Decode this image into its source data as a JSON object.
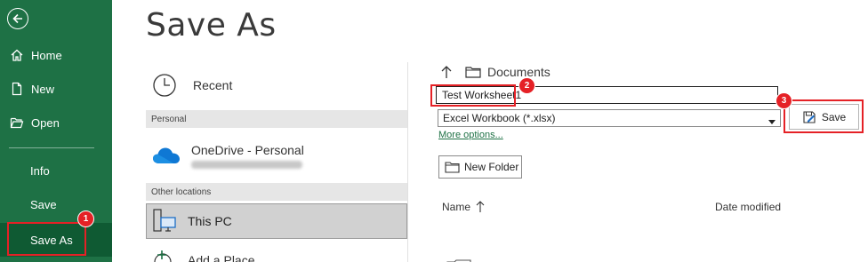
{
  "sidebar": {
    "back_icon": "back-arrow-icon",
    "items": [
      {
        "label": "Home",
        "icon": "home-icon"
      },
      {
        "label": "New",
        "icon": "new-document-icon"
      },
      {
        "label": "Open",
        "icon": "folder-open-icon"
      },
      {
        "label": "Info"
      },
      {
        "label": "Save"
      },
      {
        "label": "Save As",
        "active": true
      }
    ]
  },
  "page": {
    "title": "Save As"
  },
  "locations": {
    "recent_label": "Recent",
    "personal_header": "Personal",
    "onedrive_label": "OneDrive - Personal",
    "other_header": "Other locations",
    "thispc_label": "This PC",
    "addplace_label": "Add a Place"
  },
  "right": {
    "folder_label": "Documents",
    "filename_value": "Test Worksheet1",
    "filetype_value": "Excel Workbook (*.xlsx)",
    "more_options": "More options...",
    "save_label": "Save",
    "new_folder_label": "New Folder",
    "col_name": "Name",
    "col_date": "Date modified"
  },
  "annotations": {
    "badge1": "1",
    "badge2": "2",
    "badge3": "3"
  },
  "colors": {
    "sidebar": "#1e7145",
    "highlight": "#e52126",
    "link": "#1e7145"
  }
}
